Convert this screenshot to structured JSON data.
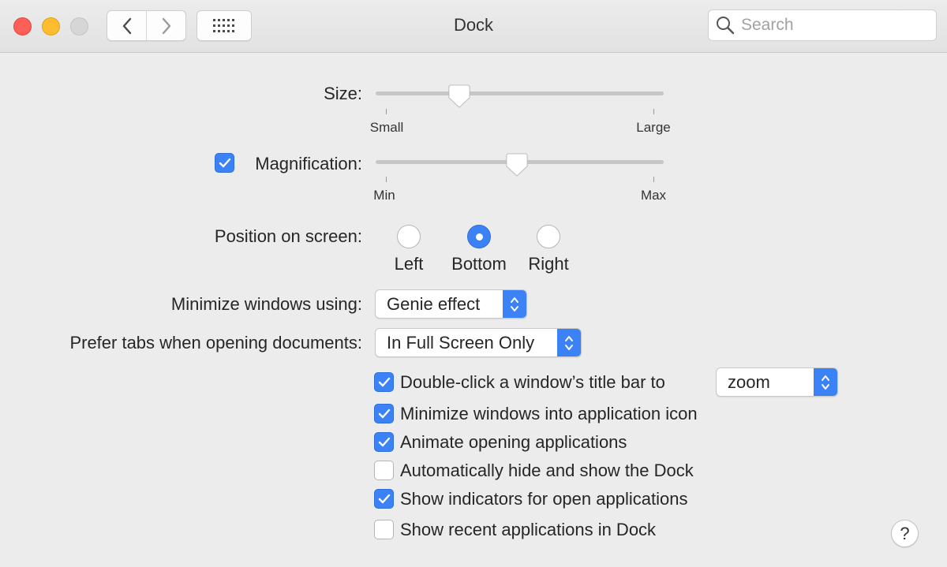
{
  "window": {
    "title": "Dock",
    "search_placeholder": "Search"
  },
  "size": {
    "label": "Size:",
    "min_label": "Small",
    "max_label": "Large",
    "value_fraction": 0.29
  },
  "magnification": {
    "label": "Magnification:",
    "checked": true,
    "min_label": "Min",
    "max_label": "Max",
    "value_fraction": 0.49
  },
  "position": {
    "label": "Position on screen:",
    "options": [
      "Left",
      "Bottom",
      "Right"
    ],
    "selected": "Bottom"
  },
  "minimize": {
    "label": "Minimize windows using:",
    "value": "Genie effect"
  },
  "prefer_tabs": {
    "label": "Prefer tabs when opening documents:",
    "value": "In Full Screen Only"
  },
  "options": [
    {
      "label": "Double-click a window’s title bar to",
      "checked": true,
      "popup_value": "zoom"
    },
    {
      "label": "Minimize windows into application icon",
      "checked": true
    },
    {
      "label": "Animate opening applications",
      "checked": true
    },
    {
      "label": "Automatically hide and show the Dock",
      "checked": false
    },
    {
      "label": "Show indicators for open applications",
      "checked": true
    },
    {
      "label": "Show recent applications in Dock",
      "checked": false
    }
  ],
  "help_label": "?",
  "colors": {
    "accent": "#3b82f6"
  }
}
